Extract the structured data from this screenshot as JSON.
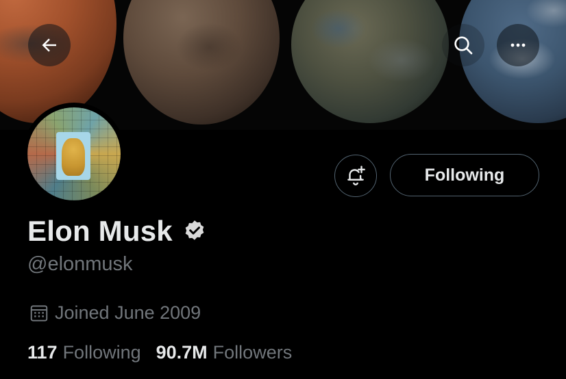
{
  "banner": {
    "back_icon": "arrow-left-icon",
    "search_icon": "search-icon",
    "more_icon": "more-horizontal-icon"
  },
  "profile": {
    "display_name": "Elon Musk",
    "handle": "@elonmusk",
    "verified_icon": "verified-badge-icon",
    "joined_icon": "calendar-icon",
    "joined_text": "Joined June 2009"
  },
  "actions": {
    "notify_icon": "bell-plus-icon",
    "following_label": "Following"
  },
  "stats": {
    "following_count": "117",
    "following_label": "Following",
    "followers_count": "90.7M",
    "followers_label": "Followers"
  },
  "colors": {
    "background": "#000000",
    "primary_text": "#e7e9ea",
    "secondary_text": "#71767b",
    "border": "#536471"
  }
}
